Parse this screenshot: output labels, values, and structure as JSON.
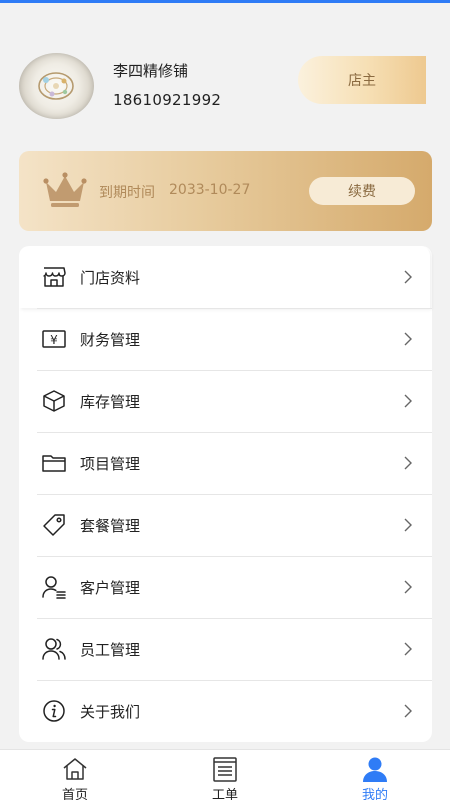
{
  "profile": {
    "shop_name": "李四精修铺",
    "phone": "18610921992",
    "role": "店主"
  },
  "vip": {
    "expire_label": "到期时间",
    "expire_date": "2033-10-27",
    "renew_label": "续费"
  },
  "menu": {
    "items": [
      {
        "label": "门店资料",
        "icon": "store-icon"
      },
      {
        "label": "财务管理",
        "icon": "finance-icon"
      },
      {
        "label": "库存管理",
        "icon": "inventory-box-icon"
      },
      {
        "label": "项目管理",
        "icon": "folder-icon"
      },
      {
        "label": "套餐管理",
        "icon": "tag-icon"
      },
      {
        "label": "客户管理",
        "icon": "customer-icon"
      },
      {
        "label": "员工管理",
        "icon": "staff-icon"
      },
      {
        "label": "关于我们",
        "icon": "info-icon"
      }
    ]
  },
  "tabbar": {
    "tabs": [
      {
        "label": "首页",
        "icon": "home-icon"
      },
      {
        "label": "工单",
        "icon": "work-order-icon"
      },
      {
        "label": "我的",
        "icon": "user-icon"
      }
    ],
    "active_index": 2,
    "active_color": "#2f7cf6"
  },
  "colors": {
    "accent": "#2f7cf6",
    "gold_text": "#8a6a40"
  }
}
